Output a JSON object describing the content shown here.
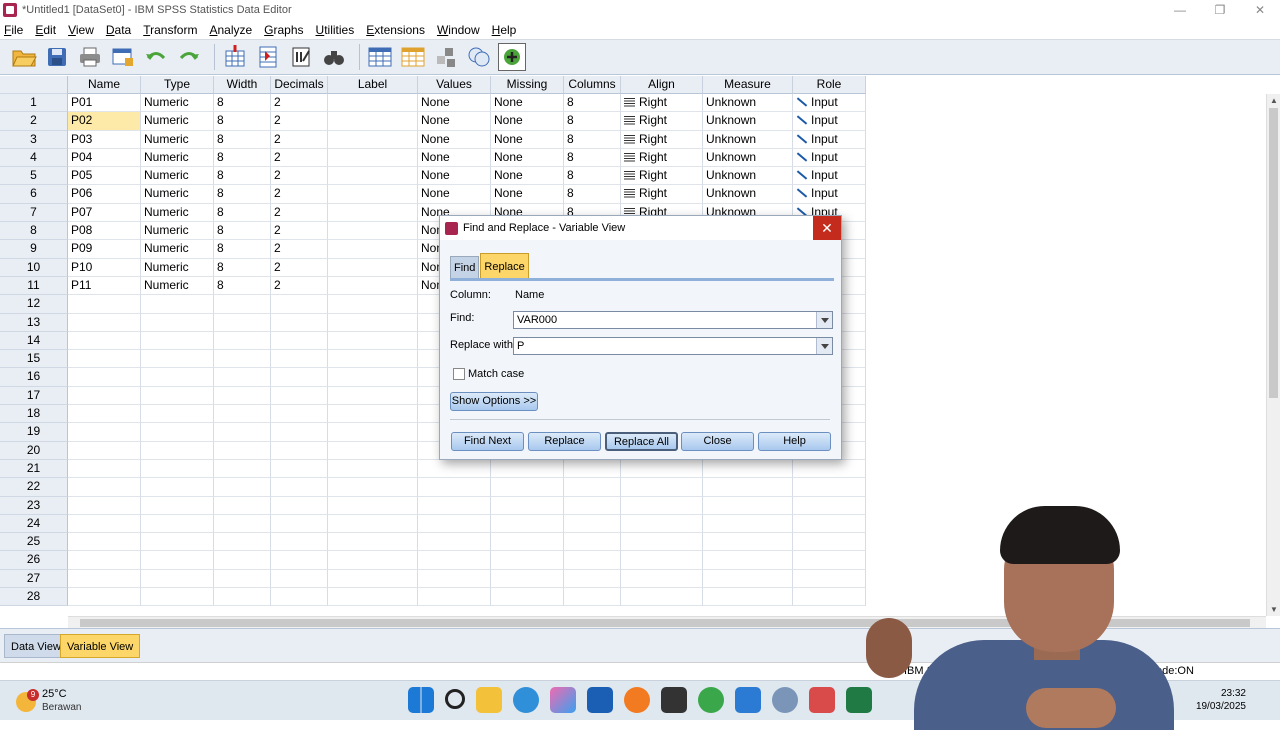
{
  "window": {
    "title": "*Untitled1 [DataSet0] - IBM SPSS Statistics Data Editor"
  },
  "menu": [
    "File",
    "Edit",
    "View",
    "Data",
    "Transform",
    "Analyze",
    "Graphs",
    "Utilities",
    "Extensions",
    "Window",
    "Help"
  ],
  "toolbar": {
    "icons": [
      "open-icon",
      "save-icon",
      "print-icon",
      "dialog-recall-icon",
      "undo-icon",
      "redo-icon",
      "goto-case-icon",
      "goto-variable-icon",
      "variables-icon",
      "run-descriptives-icon",
      "find-icon",
      "insert-cases-icon",
      "insert-variable-icon",
      "split-file-icon",
      "weight-cases-icon",
      "select-cases-icon",
      "value-labels-icon",
      "use-variable-sets-icon"
    ]
  },
  "grid": {
    "headers": [
      "Name",
      "Type",
      "Width",
      "Decimals",
      "Label",
      "Values",
      "Missing",
      "Columns",
      "Align",
      "Measure",
      "Role"
    ],
    "rows": [
      [
        "P01",
        "Numeric",
        "8",
        "2",
        "",
        "None",
        "None",
        "8",
        "Right",
        "Unknown",
        "Input"
      ],
      [
        "P02",
        "Numeric",
        "8",
        "2",
        "",
        "None",
        "None",
        "8",
        "Right",
        "Unknown",
        "Input"
      ],
      [
        "P03",
        "Numeric",
        "8",
        "2",
        "",
        "None",
        "None",
        "8",
        "Right",
        "Unknown",
        "Input"
      ],
      [
        "P04",
        "Numeric",
        "8",
        "2",
        "",
        "None",
        "None",
        "8",
        "Right",
        "Unknown",
        "Input"
      ],
      [
        "P05",
        "Numeric",
        "8",
        "2",
        "",
        "None",
        "None",
        "8",
        "Right",
        "Unknown",
        "Input"
      ],
      [
        "P06",
        "Numeric",
        "8",
        "2",
        "",
        "None",
        "None",
        "8",
        "Right",
        "Unknown",
        "Input"
      ],
      [
        "P07",
        "Numeric",
        "8",
        "2",
        "",
        "None",
        "None",
        "8",
        "Right",
        "Unknown",
        "Input"
      ],
      [
        "P08",
        "Numeric",
        "8",
        "2",
        "",
        "None",
        "",
        "",
        "",
        "",
        ""
      ],
      [
        "P09",
        "Numeric",
        "8",
        "2",
        "",
        "None",
        "",
        "",
        "",
        "",
        ""
      ],
      [
        "P10",
        "Numeric",
        "8",
        "2",
        "",
        "None",
        "",
        "",
        "",
        "",
        ""
      ],
      [
        "P11",
        "Numeric",
        "8",
        "2",
        "",
        "None",
        "",
        "",
        "",
        "",
        ""
      ]
    ],
    "row_numbers": [
      "1",
      "2",
      "3",
      "4",
      "5",
      "6",
      "7",
      "8",
      "9",
      "10",
      "11",
      "12",
      "13",
      "14",
      "15",
      "16",
      "17",
      "18",
      "19",
      "20",
      "21",
      "22",
      "23",
      "24",
      "25",
      "26",
      "27",
      "28"
    ],
    "selected_cell": "P02"
  },
  "tabs": {
    "data_view": "Data View",
    "variable_view": "Variable View"
  },
  "status": {
    "processor": "IBM SPSS Statis",
    "encoding": "Unicode:ON"
  },
  "dialog": {
    "title": "Find and Replace - Variable View",
    "tab_find": "Find",
    "tab_replace": "Replace",
    "column_label": "Column:",
    "column_value": "Name",
    "find_label": "Find:",
    "find_value": "VAR000",
    "replace_label": "Replace with:",
    "replace_value": "P",
    "match_case": "Match case",
    "show_options": "Show Options >>",
    "buttons": {
      "find_next": "Find Next",
      "replace": "Replace",
      "replace_all": "Replace All",
      "close": "Close",
      "help": "Help"
    }
  },
  "taskbar": {
    "weather_badge": "9",
    "temperature": "25°C",
    "weather_desc": "Berawan",
    "time": "23:32",
    "date": "19/03/2025"
  }
}
